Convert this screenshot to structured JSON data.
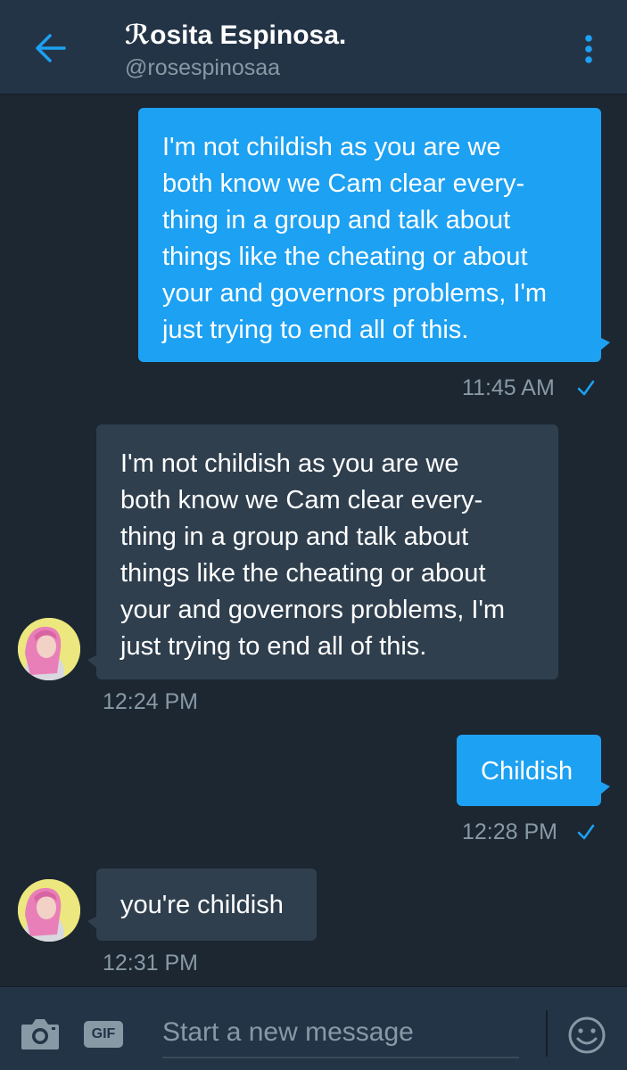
{
  "header": {
    "title": "ℛosita Espinosa.",
    "handle": "@rosespinosaa"
  },
  "messages": [
    {
      "direction": "sent",
      "text": "I'm not childish as you are we\nboth know we Cam clear every-\nthing in a group and talk about\nthings like the cheating or about\nyour and governors problems, I'm\njust trying to end all of this.",
      "time": "11:45 AM",
      "read": true
    },
    {
      "direction": "received",
      "text": "I'm not childish as you are we\nboth know we Cam clear every-\nthing in a group and talk about\nthings like the cheating or about\nyour and governors problems, I'm\njust trying to end all of this.",
      "time": "12:24 PM"
    },
    {
      "direction": "sent",
      "text": "Childish",
      "time": "12:28 PM",
      "read": true
    },
    {
      "direction": "received",
      "text": "you're childish",
      "time": "12:31 PM"
    }
  ],
  "compose": {
    "placeholder": "Start a new message",
    "gif_label": "GIF"
  },
  "colors": {
    "background": "#1c2732",
    "header": "#243447",
    "sent_bubble": "#1da1f2",
    "received_bubble": "#2f3f4e",
    "accent": "#1da1f2",
    "muted_text": "#8899a6"
  },
  "icons": {
    "back": "arrow-left-icon",
    "more": "more-vertical-icon",
    "read": "checkmark-icon",
    "camera": "camera-icon",
    "emoji": "smiley-icon"
  }
}
